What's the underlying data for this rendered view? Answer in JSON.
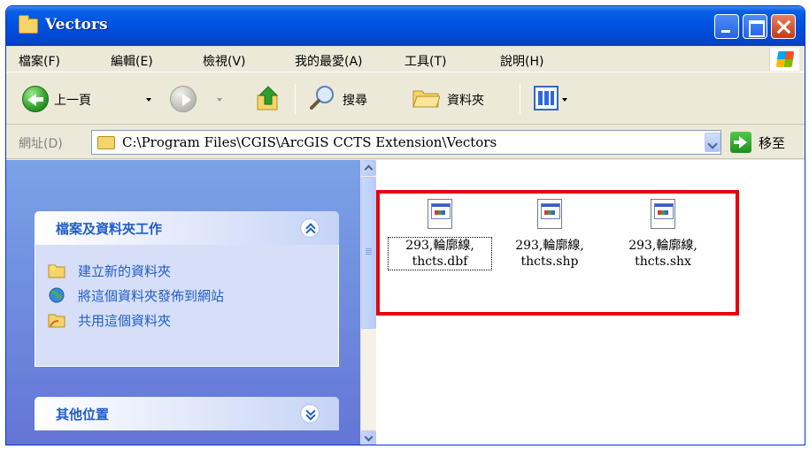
{
  "window": {
    "title": "Vectors"
  },
  "menu": [
    {
      "label": "檔案(F)"
    },
    {
      "label": "編輯(E)"
    },
    {
      "label": "檢視(V)"
    },
    {
      "label": "我的最愛(A)"
    },
    {
      "label": "工具(T)"
    },
    {
      "label": "說明(H)"
    }
  ],
  "toolbar": {
    "back_label": "上一頁",
    "search_label": "搜尋",
    "folders_label": "資料夾"
  },
  "address": {
    "label": "網址(D)",
    "path": "C:\\Program Files\\CGIS\\ArcGIS CCTS Extension\\Vectors",
    "go_label": "移至"
  },
  "taskpane": {
    "file_tasks": {
      "title": "檔案及資料夾工作",
      "items": [
        {
          "label": "建立新的資料夾",
          "icon": "new-folder-icon"
        },
        {
          "label": "將這個資料夾發佈到網站",
          "icon": "publish-web-icon"
        },
        {
          "label": "共用這個資料夾",
          "icon": "share-folder-icon"
        }
      ]
    },
    "other_places": {
      "title": "其他位置"
    }
  },
  "files": [
    {
      "line1": "293,輪廓線,",
      "line2": "thcts.dbf",
      "selected": true
    },
    {
      "line1": "293,輪廓線,",
      "line2": "thcts.shp",
      "selected": false
    },
    {
      "line1": "293,輪廓線,",
      "line2": "thcts.shx",
      "selected": false
    }
  ],
  "colors": {
    "title_bar": "#0054e3",
    "task_link": "#215dc6",
    "highlight": "#e8000b"
  }
}
